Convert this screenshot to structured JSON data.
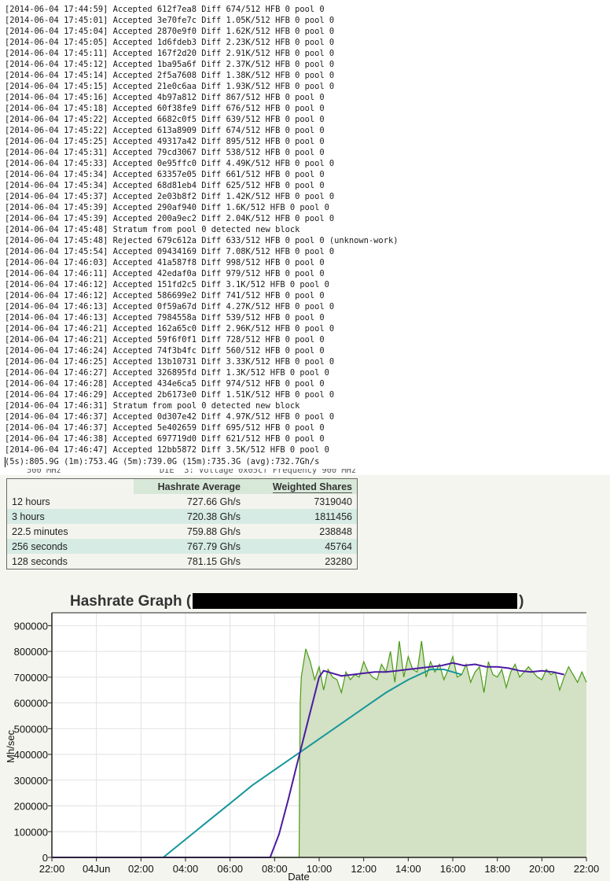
{
  "console": {
    "lines": [
      "[2014-06-04 17:44:59] Accepted 612f7ea8 Diff 674/512 HFB 0 pool 0",
      "[2014-06-04 17:45:01] Accepted 3e70fe7c Diff 1.05K/512 HFB 0 pool 0",
      "[2014-06-04 17:45:04] Accepted 2870e9f0 Diff 1.62K/512 HFB 0 pool 0",
      "[2014-06-04 17:45:05] Accepted 1d6fdeb3 Diff 2.23K/512 HFB 0 pool 0",
      "[2014-06-04 17:45:11] Accepted 167f2d20 Diff 2.91K/512 HFB 0 pool 0",
      "[2014-06-04 17:45:12] Accepted 1ba95a6f Diff 2.37K/512 HFB 0 pool 0",
      "[2014-06-04 17:45:14] Accepted 2f5a7608 Diff 1.38K/512 HFB 0 pool 0",
      "[2014-06-04 17:45:15] Accepted 21e0c6aa Diff 1.93K/512 HFB 0 pool 0",
      "[2014-06-04 17:45:16] Accepted 4b97a812 Diff 867/512 HFB 0 pool 0",
      "[2014-06-04 17:45:18] Accepted 60f38fe9 Diff 676/512 HFB 0 pool 0",
      "[2014-06-04 17:45:22] Accepted 6682c0f5 Diff 639/512 HFB 0 pool 0",
      "[2014-06-04 17:45:22] Accepted 613a8909 Diff 674/512 HFB 0 pool 0",
      "[2014-06-04 17:45:25] Accepted 49317a42 Diff 895/512 HFB 0 pool 0",
      "[2014-06-04 17:45:31] Accepted 79cd3067 Diff 538/512 HFB 0 pool 0",
      "[2014-06-04 17:45:33] Accepted 0e95ffc0 Diff 4.49K/512 HFB 0 pool 0",
      "[2014-06-04 17:45:34] Accepted 63357e05 Diff 661/512 HFB 0 pool 0",
      "[2014-06-04 17:45:34] Accepted 68d81eb4 Diff 625/512 HFB 0 pool 0",
      "[2014-06-04 17:45:37] Accepted 2e03b8f2 Diff 1.42K/512 HFB 0 pool 0",
      "[2014-06-04 17:45:39] Accepted 290af940 Diff 1.6K/512 HFB 0 pool 0",
      "[2014-06-04 17:45:39] Accepted 200a9ec2 Diff 2.04K/512 HFB 0 pool 0",
      "[2014-06-04 17:45:48] Stratum from pool 0 detected new block",
      "[2014-06-04 17:45:48] Rejected 679c612a Diff 633/512 HFB 0 pool 0 (unknown-work)",
      "[2014-06-04 17:45:54] Accepted 09434169 Diff 7.08K/512 HFB 0 pool 0",
      "[2014-06-04 17:46:03] Accepted 41a587f8 Diff 998/512 HFB 0 pool 0",
      "[2014-06-04 17:46:11] Accepted 42edaf0a Diff 979/512 HFB 0 pool 0",
      "[2014-06-04 17:46:12] Accepted 151fd2c5 Diff 3.1K/512 HFB 0 pool 0",
      "[2014-06-04 17:46:12] Accepted 586699e2 Diff 741/512 HFB 0 pool 0",
      "[2014-06-04 17:46:13] Accepted 0f59a67d Diff 4.27K/512 HFB 0 pool 0",
      "[2014-06-04 17:46:13] Accepted 7984558a Diff 539/512 HFB 0 pool 0",
      "[2014-06-04 17:46:21] Accepted 162a65c0 Diff 2.96K/512 HFB 0 pool 0",
      "[2014-06-04 17:46:21] Accepted 59f6f0f1 Diff 728/512 HFB 0 pool 0",
      "[2014-06-04 17:46:24] Accepted 74f3b4fc Diff 560/512 HFB 0 pool 0",
      "[2014-06-04 17:46:25] Accepted 13b10731 Diff 3.33K/512 HFB 0 pool 0",
      "[2014-06-04 17:46:27] Accepted 326895fd Diff 1.3K/512 HFB 0 pool 0",
      "[2014-06-04 17:46:28] Accepted 434e6ca5 Diff 974/512 HFB 0 pool 0",
      "[2014-06-04 17:46:29] Accepted 2b6173e0 Diff 1.51K/512 HFB 0 pool 0",
      "[2014-06-04 17:46:31] Stratum from pool 0 detected new block",
      "[2014-06-04 17:46:37] Accepted 0d307e42 Diff 4.97K/512 HFB 0 pool 0",
      "[2014-06-04 17:46:37] Accepted 5e402659 Diff 695/512 HFB 0 pool 0",
      "[2014-06-04 17:46:38] Accepted 697719d0 Diff 621/512 HFB 0 pool 0",
      "[2014-06-04 17:46:47] Accepted 12bb5872 Diff 3.5K/512 HFB 0 pool 0"
    ],
    "status": "(5s):805.9G (1m):753.4G (5m):739.0G (15m):735.3G (avg):732.7Gh/s",
    "clipped_text": "500 MHz                    DIE  3: Voltage 0x05cf Frequency 900 MHz"
  },
  "stats_table": {
    "headers": [
      "",
      "Hashrate Average",
      "Weighted Shares"
    ],
    "rows": [
      [
        "12 hours",
        "727.66 Gh/s",
        "7319040"
      ],
      [
        "3 hours",
        "720.38 Gh/s",
        "1811456"
      ],
      [
        "22.5 minutes",
        "759.88 Gh/s",
        "238848"
      ],
      [
        "256 seconds",
        "767.79 Gh/s",
        "45764"
      ],
      [
        "128 seconds",
        "781.15 Gh/s",
        "23280"
      ]
    ]
  },
  "graph": {
    "title_left": "Hashrate Graph (",
    "title_right": ")"
  },
  "chart_data": {
    "type": "area",
    "xlabel": "Date",
    "ylabel": "Mh/sec",
    "ylim": [
      0,
      950000
    ],
    "xlim": [
      0,
      24
    ],
    "x_unit": "hours from 22:00 (Jun 3) to 22:00 (Jun 4)",
    "x_ticks": [
      "22:00",
      "04Jun",
      "02:00",
      "04:00",
      "06:00",
      "08:00",
      "10:00",
      "12:00",
      "14:00",
      "16:00",
      "18:00",
      "20:00",
      "22:00"
    ],
    "y_ticks": [
      "0",
      "100000",
      "200000",
      "300000",
      "400000",
      "500000",
      "600000",
      "700000",
      "800000",
      "900000"
    ],
    "grid": true,
    "colors": {
      "area_fill": "#d3e1c4",
      "raw": "#4a9a14",
      "avg_long": "#16969a",
      "avg_short": "#4b1aa2"
    },
    "series": [
      {
        "x": [
          0,
          11.1,
          11.15,
          11.2,
          11.4,
          11.6,
          11.8,
          12.0,
          12.2,
          12.4,
          12.6,
          12.8,
          13.0,
          13.2,
          13.4,
          13.6,
          13.8,
          14.0,
          14.2,
          14.4,
          14.6,
          14.8,
          15.0,
          15.2,
          15.4,
          15.6,
          15.8,
          16.0,
          16.2,
          16.4,
          16.6,
          16.8,
          17.0,
          17.2,
          17.4,
          17.6,
          17.8,
          18.0,
          18.2,
          18.4,
          18.6,
          18.8,
          19.0,
          19.2,
          19.4,
          19.6,
          19.8,
          20.0,
          20.2,
          20.4,
          20.6,
          20.8,
          21.0,
          21.2,
          21.4,
          21.6,
          21.8,
          22.0,
          22.2,
          22.4,
          22.6,
          22.8,
          23.0,
          23.2,
          23.4,
          23.6,
          23.8,
          24.0
        ],
        "values": [
          0,
          0,
          600000,
          700000,
          810000,
          760000,
          690000,
          740000,
          650000,
          730000,
          700000,
          690000,
          640000,
          720000,
          690000,
          710000,
          700000,
          760000,
          720000,
          700000,
          690000,
          750000,
          720000,
          800000,
          680000,
          840000,
          700000,
          780000,
          730000,
          720000,
          840000,
          700000,
          760000,
          720000,
          750000,
          690000,
          730000,
          780000,
          700000,
          710000,
          750000,
          680000,
          720000,
          740000,
          640000,
          760000,
          710000,
          700000,
          730000,
          660000,
          720000,
          750000,
          700000,
          720000,
          740000,
          720000,
          700000,
          690000,
          730000,
          710000,
          720000,
          650000,
          700000,
          740000,
          710000,
          680000,
          720000,
          680000
        ]
      },
      {
        "x": [
          0,
          5.0,
          6.0,
          7.0,
          8.0,
          9.0,
          10.0,
          11.0,
          12.0,
          13.0,
          14.0,
          15.0,
          16.0,
          17.0,
          17.6,
          18.0,
          18.4
        ],
        "values": [
          0,
          0,
          70000,
          140000,
          210000,
          280000,
          340000,
          400000,
          460000,
          520000,
          580000,
          640000,
          690000,
          730000,
          730000,
          720000,
          710000
        ]
      },
      {
        "x": [
          0,
          9.8,
          10.2,
          10.6,
          11.0,
          11.5,
          12.0,
          12.2,
          12.6,
          13.0,
          13.5,
          14.0,
          14.5,
          15.0,
          15.5,
          16.0,
          16.5,
          17.0,
          17.5,
          18.0,
          18.5,
          19.0,
          19.5,
          20.0,
          20.5,
          21.0,
          21.5,
          22.0,
          22.5,
          23.0
        ],
        "values": [
          0,
          0,
          90000,
          220000,
          360000,
          530000,
          700000,
          725000,
          715000,
          705000,
          710000,
          715000,
          720000,
          720000,
          725000,
          730000,
          735000,
          740000,
          745000,
          755000,
          745000,
          750000,
          740000,
          740000,
          735000,
          725000,
          720000,
          725000,
          720000,
          710000
        ]
      }
    ]
  }
}
